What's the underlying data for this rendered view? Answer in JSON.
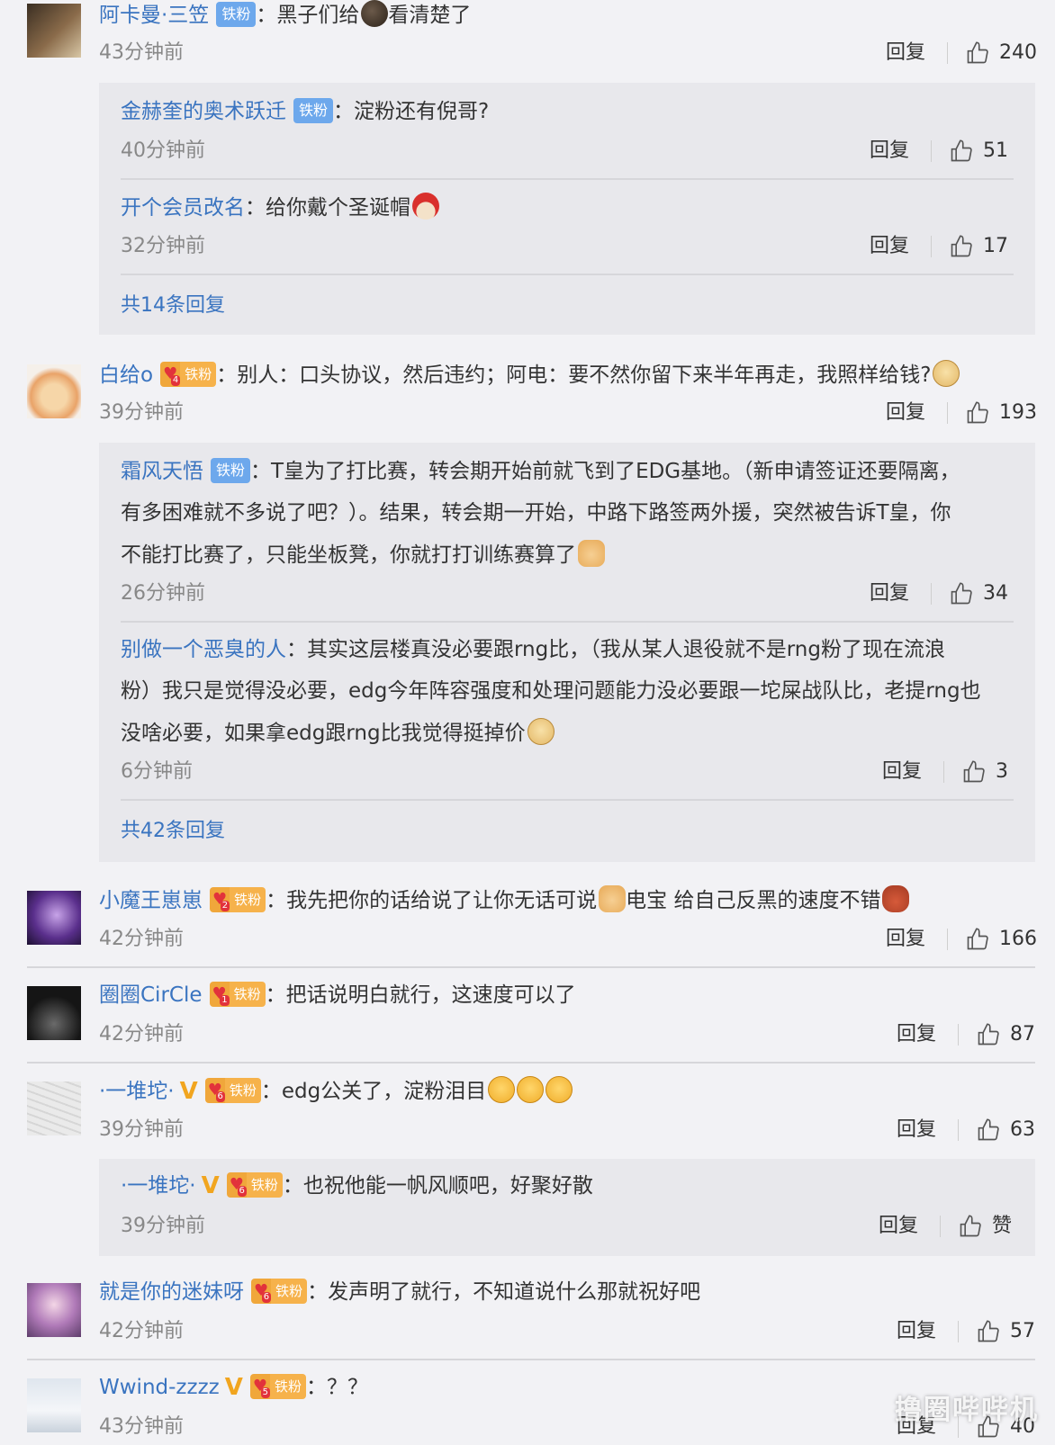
{
  "comments": [
    {
      "user": "阿卡曼·三笠",
      "badge": "铁粉",
      "sep": "：",
      "text": "黑子们给",
      "text2": "看清楚了",
      "time": "43分钟前",
      "reply": "回复",
      "likes": "240"
    },
    {
      "user": "白给o",
      "badge": "铁粉",
      "sep": "：",
      "text": "别人：口头协议，然后违约；阿电：要不然你留下来半年再走，我照样给钱?",
      "time": "39分钟前",
      "reply": "回复",
      "likes": "193"
    },
    {
      "user": "小魔王崽崽",
      "badge": "铁粉",
      "sep": "：",
      "text": "我先把你的话给说了让你无话可说",
      "text2": "电宝 给自己反黑的速度不错",
      "time": "42分钟前",
      "reply": "回复",
      "likes": "166"
    },
    {
      "user": "圈圈CirCle",
      "badge": "铁粉",
      "sep": "：",
      "text": "把话说明白就行，这速度可以了",
      "time": "42分钟前",
      "reply": "回复",
      "likes": "87"
    },
    {
      "user": "·一堆坨·",
      "badge": "铁粉",
      "sep": "：",
      "text": "edg公关了，淀粉泪目",
      "time": "39分钟前",
      "reply": "回复",
      "likes": "63"
    },
    {
      "user": "就是你的迷妹呀",
      "badge": "铁粉",
      "sep": "：",
      "text": "发声明了就行，不知道说什么那就祝好吧",
      "time": "42分钟前",
      "reply": "回复",
      "likes": "57"
    },
    {
      "user": "Wwind-zzzz",
      "badge": "铁粉",
      "sep": "：",
      "text": "？？",
      "time": "43分钟前",
      "reply": "回复",
      "likes": "40"
    }
  ],
  "replies": [
    {
      "user": "金赫奎的奥术跃迁",
      "badge": "铁粉",
      "sep": "：",
      "text": "淀粉还有倪哥?",
      "time": "40分钟前",
      "reply": "回复",
      "likes": "51"
    },
    {
      "user": "开个会员改名",
      "sep": "：",
      "text": "给你戴个圣诞帽",
      "time": "32分钟前",
      "reply": "回复",
      "likes": "17"
    },
    {
      "more": "共14条回复"
    },
    {
      "user": "霜风天悟",
      "badge": "铁粉",
      "sep": "：",
      "line1": "T皇为了打比赛，转会期开始前就飞到了EDG基地。（新申请签证还要隔离，",
      "line2": "有多困难就不多说了吧？）。结果，转会期一开始，中路下路签两外援，突然被告诉T皇，你",
      "line3": "不能打比赛了，只能坐板凳，你就打打训练赛算了",
      "time": "26分钟前",
      "reply": "回复",
      "likes": "34"
    },
    {
      "user": "别做一个恶臭的人",
      "sep": "：",
      "line1": "其实这层楼真没必要跟rng比，（我从某人退役就不是rng粉了现在流浪",
      "line2": "粉）我只是觉得没必要，edg今年阵容强度和处理问题能力没必要跟一坨屎战队比，老提rng也",
      "line3": "没啥必要，如果拿edg跟rng比我觉得挺掉价",
      "time": "6分钟前",
      "reply": "回复",
      "likes": "3"
    },
    {
      "more": "共42条回复"
    },
    {
      "user": "·一堆坨·",
      "badge": "铁粉",
      "sep": "：",
      "text": "也祝他能一帆风顺吧，好聚好散",
      "time": "39分钟前",
      "reply": "回复",
      "likes": "赞"
    }
  ],
  "watermark": "撸圈哔哔机",
  "colors": {
    "username": "#3a74c0",
    "panel": "#e8e8ec",
    "background": "#f2f2f5",
    "badge_blue": "#6da8ec",
    "badge_gold": "#f6b24b",
    "vip": "#f1a51f"
  }
}
